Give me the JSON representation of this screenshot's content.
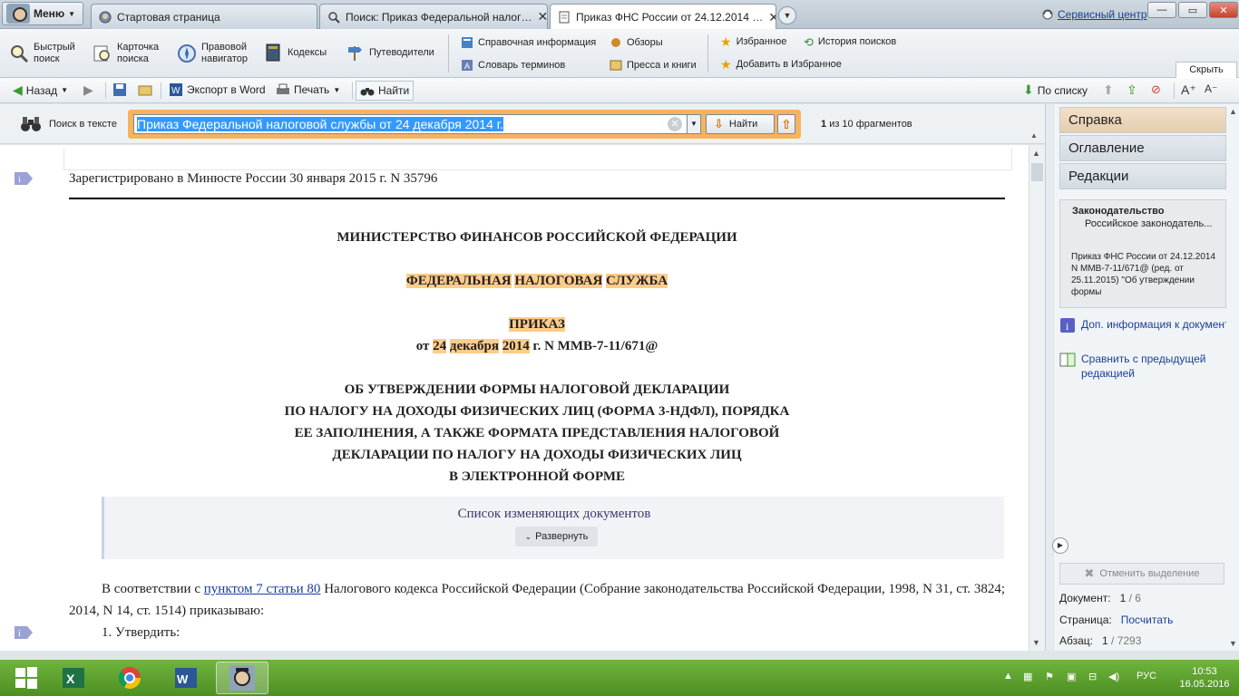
{
  "tabs": {
    "menu_label": "Меню",
    "items": [
      {
        "label": "Стартовая страница"
      },
      {
        "label": "Поиск: Приказ Федеральной налог…"
      },
      {
        "label": "Приказ ФНС России от 24.12.2014 …"
      }
    ],
    "service_center": "Сервисный центр"
  },
  "ribbon": {
    "quick_search": "Быстрый\nпоиск",
    "card_search": "Карточка\nпоиска",
    "legal_navigator": "Правовой\nнавигатор",
    "codes": "Кодексы",
    "guides": "Путеводители",
    "reference_info": "Справочная информация",
    "glossary": "Словарь терминов",
    "reviews": "Обзоры",
    "press_books": "Пресса и книги",
    "favorites": "Избранное",
    "add_favorites": "Добавить в Избранное",
    "search_history": "История поисков",
    "collapse": "Скрыть"
  },
  "toolbar": {
    "back": "Назад",
    "export_word": "Экспорт в Word",
    "print": "Печать",
    "find": "Найти",
    "by_list": "По списку"
  },
  "search": {
    "label": "Поиск в тексте",
    "query": "Приказ Федеральной налоговой службы от 24 декабря 2014 г.",
    "find_button": "Найти",
    "counter_current": "1",
    "counter_text": "из 10 фрагментов"
  },
  "document": {
    "registered": "Зарегистрировано в Минюсте России 30 января 2015 г. N 35796",
    "ministry": "МИНИСТЕРСТВО ФИНАНСОВ РОССИЙСКОЙ ФЕДЕРАЦИИ",
    "service_w1": "ФЕДЕРАЛЬНАЯ",
    "service_w2": "НАЛОГОВАЯ",
    "service_w3": "СЛУЖБА",
    "order": "ПРИКАЗ",
    "date_prefix": "от",
    "date_day": "24",
    "date_month": "декабря",
    "date_year": "2014",
    "date_suffix": "г. N ММВ-7-11/671@",
    "title_lines": [
      "ОБ УТВЕРЖДЕНИИ ФОРМЫ НАЛОГОВОЙ ДЕКЛАРАЦИИ",
      "ПО НАЛОГУ НА ДОХОДЫ ФИЗИЧЕСКИХ ЛИЦ (ФОРМА 3-НДФЛ), ПОРЯДКА",
      "ЕЕ ЗАПОЛНЕНИЯ, А ТАКЖЕ ФОРМАТА ПРЕДСТАВЛЕНИЯ НАЛОГОВОЙ",
      "ДЕКЛАРАЦИИ ПО НАЛОГУ НА ДОХОДЫ ФИЗИЧЕСКИХ ЛИЦ",
      "В ЭЛЕКТРОННОЙ ФОРМЕ"
    ],
    "changes_title": "Список изменяющих документов",
    "expand": "Развернуть",
    "para_prefix": "В соответствии с",
    "para_link": "пунктом 7 статьи 80",
    "para_rest": "Налогового кодекса Российской Федерации (Собрание законодательства Российской Федерации, 1998, N 31, ст. 3824; 2014, N 14, ст. 1514) приказываю:",
    "item1": "1. Утвердить:"
  },
  "right_panel": {
    "tab_help": "Справка",
    "tab_contents": "Оглавление",
    "tab_editions": "Редакции",
    "card_heading": "Законодательство",
    "card_sub": "Российское законодатель...",
    "card_body": "Приказ ФНС России от 24.12.2014 N ММВ-7-11/671@ (ред. от 25.11.2015) \"Об утверждении формы",
    "link_more_info": "Доп. информация к документу",
    "link_compare": "Сравнить с предыдущей редакцией",
    "cancel_selection": "Отменить выделение",
    "doc_label": "Документ:",
    "doc_current": "1",
    "doc_total": "/ 6",
    "page_label": "Страница:",
    "page_action": "Посчитать",
    "para_label": "Абзац:",
    "para_current": "1",
    "para_total": "/ 7293"
  },
  "taskbar": {
    "language": "РУС",
    "time": "10:53",
    "date": "16.05.2016"
  }
}
